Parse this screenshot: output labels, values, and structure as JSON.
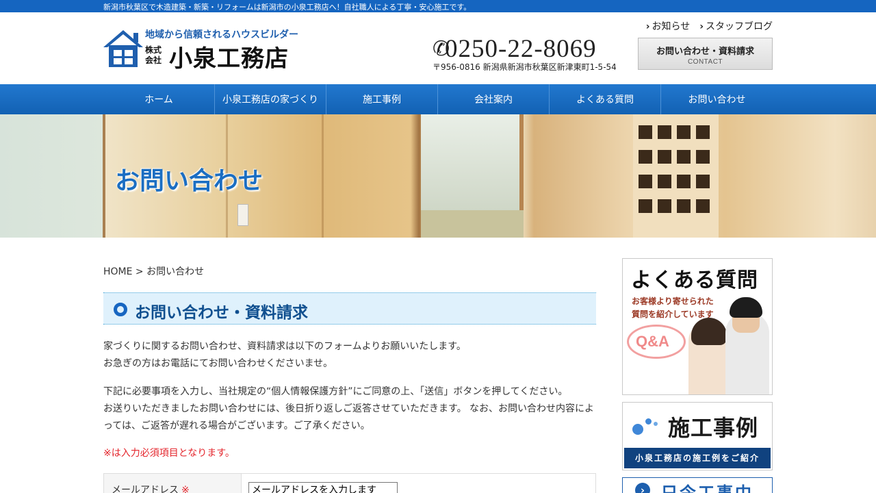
{
  "topbar": {
    "text": "新潟市秋葉区で木造建築・新築・リフォームは新潟市の小泉工務店へ！自社職人による丁寧・安心施工です。"
  },
  "header": {
    "logo_tagline": "地域から信頼されるハウスビルダー",
    "logo_kabushiki": "株式会社",
    "logo_name": "小泉工務店",
    "links": [
      {
        "chevron": "›",
        "label": "お知らせ"
      },
      {
        "chevron": "›",
        "label": "スタッフブログ"
      }
    ],
    "phone": "0250-22-8069",
    "address": "〒956-0816 新潟県新潟市秋葉区新津東町1-5-54",
    "contact_button": {
      "label": "お問い合わせ・資料請求",
      "sub": "CONTACT"
    }
  },
  "nav": [
    "ホーム",
    "小泉工務店の家づくり",
    "施工事例",
    "会社案内",
    "よくある質問",
    "お問い合わせ"
  ],
  "hero": {
    "title": "お問い合わせ"
  },
  "breadcrumb": {
    "home": "HOME",
    "separator": " > ",
    "current": "お問い合わせ"
  },
  "section": {
    "title": "お問い合わせ・資料請求"
  },
  "intro": {
    "line1": "家づくりに関するお問い合わせ、資料請求は以下のフォームよりお願いいたします。",
    "line2": "お急ぎの方はお電話にてお問い合わせくださいませ。",
    "line3": "下記に必要事項を入力し、当社規定の“個人情報保護方針”にご同意の上、「送信」ボタンを押してください。",
    "line4": "お送りいただきましたお問い合わせには、後日折り返しご返答させていただきます。 なお、お問い合わせ内容によっては、ご返答が遅れる場合がございます。ご了承ください。"
  },
  "required_note": "※は入力必須項目となります。",
  "form": {
    "email": {
      "label": "メールアドレス",
      "required_mark": "※",
      "placeholder": "メールアドレスを入力します"
    }
  },
  "sidebar": {
    "faq": {
      "title": "よくある質問",
      "sub1": "お客様より寄せられた",
      "sub2": "質問を紹介しています",
      "qa": "Q&A"
    },
    "works": {
      "title": "施工事例",
      "band": "小泉工務店の施工例をご紹介"
    },
    "now": {
      "arrow": "›",
      "title": "只今工事中"
    }
  },
  "colors": {
    "brand_blue": "#1565c0",
    "nav_blue": "#1261b3",
    "accent_red": "#e4262d",
    "section_bg": "#dff1fc"
  }
}
